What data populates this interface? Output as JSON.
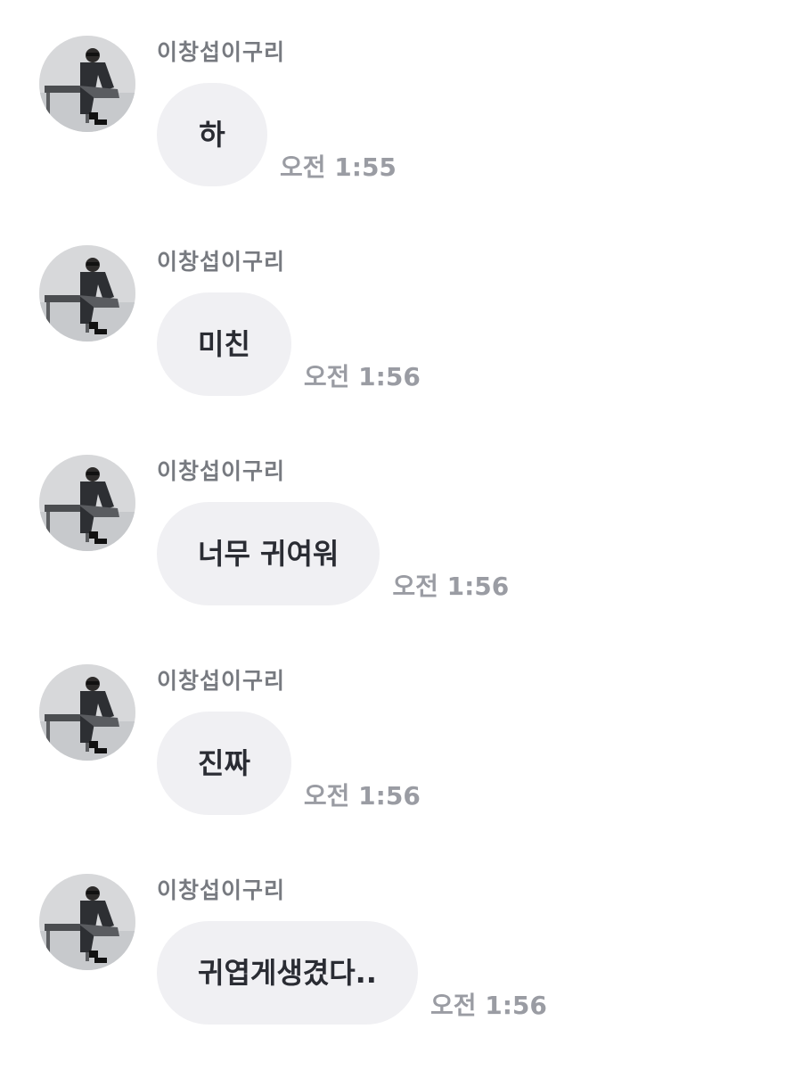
{
  "messages": [
    {
      "sender": "이창섭이구리",
      "text": "하",
      "time": "오전 1:55"
    },
    {
      "sender": "이창섭이구리",
      "text": "미친",
      "time": "오전 1:56"
    },
    {
      "sender": "이창섭이구리",
      "text": "너무 귀여워",
      "time": "오전 1:56"
    },
    {
      "sender": "이창섭이구리",
      "text": "진짜",
      "time": "오전 1:56"
    },
    {
      "sender": "이창섭이구리",
      "text": "귀엽게생겼다..",
      "time": "오전 1:56"
    }
  ],
  "colors": {
    "bubble": "#f0f0f3",
    "message_text": "#2a2c33",
    "sender_name": "#777a80",
    "timestamp": "#9a9ca3"
  },
  "icons": {
    "avatar": "profile-photo-icon"
  }
}
